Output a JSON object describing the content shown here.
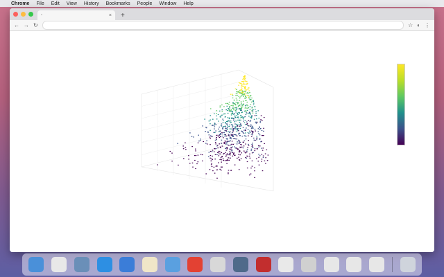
{
  "menubar": {
    "app_name": "Chrome",
    "items": [
      "File",
      "Edit",
      "View",
      "History",
      "Bookmarks",
      "People",
      "Window",
      "Help"
    ]
  },
  "browser": {
    "tab_title": "",
    "address": ""
  },
  "plot": {
    "title": "",
    "colorbar_ticks": [
      "",
      "",
      "",
      "",
      ""
    ]
  },
  "dock": {
    "icons": [
      {
        "name": "finder",
        "color": "#4a90d9"
      },
      {
        "name": "photos",
        "color": "#e8e8e8"
      },
      {
        "name": "app-3",
        "color": "#6a8fb8"
      },
      {
        "name": "safari",
        "color": "#2d8fe3"
      },
      {
        "name": "app-5",
        "color": "#3b7dd8"
      },
      {
        "name": "preview",
        "color": "#f0e6c8"
      },
      {
        "name": "app-7",
        "color": "#5aa0e0"
      },
      {
        "name": "chrome",
        "color": "#e34133"
      },
      {
        "name": "app-9",
        "color": "#d8d8d8"
      },
      {
        "name": "app-10",
        "color": "#4f6a8a"
      },
      {
        "name": "app-11",
        "color": "#c22e2e"
      },
      {
        "name": "app-12",
        "color": "#e9e9e9"
      },
      {
        "name": "app-13",
        "color": "#d0d0d0"
      },
      {
        "name": "app-14",
        "color": "#e7e7e7"
      },
      {
        "name": "app-15",
        "color": "#e7e7e7"
      },
      {
        "name": "app-16",
        "color": "#e7e7e7"
      },
      {
        "name": "trash",
        "color": "#cfd4dc"
      }
    ]
  },
  "chart_data": {
    "type": "scatter",
    "title": "",
    "colormap": "viridis",
    "colors": [
      "#fde725",
      "#5ec962",
      "#21918c",
      "#3b528b",
      "#440154"
    ]
  }
}
